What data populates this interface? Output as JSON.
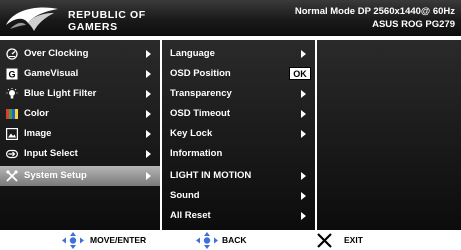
{
  "header": {
    "brand_line1": "REPUBLIC OF",
    "brand_line2": "GAMERS",
    "mode_line1": "Normal Mode DP 2560x1440@ 60Hz",
    "mode_line2": "ASUS ROG PG279"
  },
  "main_menu": [
    {
      "label": "Over Clocking",
      "icon": "gauge-icon",
      "selected": false
    },
    {
      "label": "GameVisual",
      "icon": "gamevisual-icon",
      "selected": false
    },
    {
      "label": "Blue Light Filter",
      "icon": "light-bulb-icon",
      "selected": false
    },
    {
      "label": "Color",
      "icon": "color-icon",
      "selected": false
    },
    {
      "label": "Image",
      "icon": "image-icon",
      "selected": false
    },
    {
      "label": "Input Select",
      "icon": "input-select-icon",
      "selected": false
    },
    {
      "label": "System Setup",
      "icon": "wrench-icon",
      "selected": true
    }
  ],
  "submenu": [
    {
      "label": "Language",
      "arrow": true
    },
    {
      "label": "OSD Position",
      "badge": "OK"
    },
    {
      "label": "Transparency",
      "arrow": true
    },
    {
      "label": "OSD Timeout",
      "arrow": true
    },
    {
      "label": "Key Lock",
      "arrow": true
    },
    {
      "label": "Information"
    },
    {
      "label": "LIGHT IN MOTION",
      "arrow": true
    },
    {
      "label": "Sound",
      "arrow": true
    },
    {
      "label": "All Reset",
      "arrow": true
    }
  ],
  "footer": {
    "move_enter": "MOVE/ENTER",
    "back": "BACK",
    "exit": "EXIT"
  },
  "colors": {
    "panel": "#1a1a1a",
    "selected": "#9a9a9a",
    "nav_blue": "#3f6fd8"
  }
}
